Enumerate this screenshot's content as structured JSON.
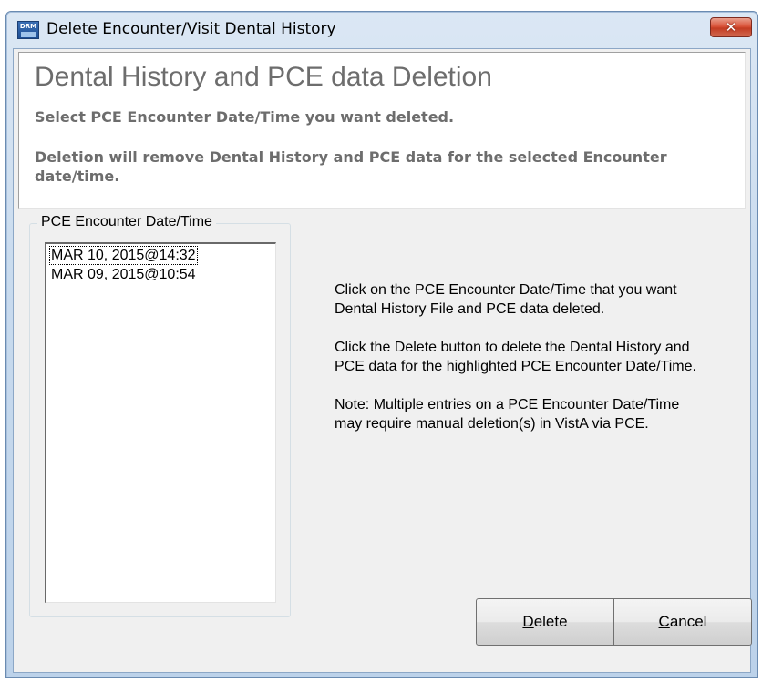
{
  "window": {
    "title": "Delete Encounter/Visit Dental History",
    "app_icon_text_top": "DRM",
    "close_glyph": "✕"
  },
  "header": {
    "title": "Dental History and PCE data Deletion",
    "line1": "Select PCE Encounter Date/Time you want deleted.",
    "line2": "Deletion will remove Dental History and PCE data for the selected Encounter date/time."
  },
  "group": {
    "legend": "PCE Encounter Date/Time",
    "items": [
      {
        "label": "MAR 10, 2015@14:32",
        "focused": true
      },
      {
        "label": "MAR 09, 2015@10:54",
        "focused": false
      }
    ]
  },
  "instructions": {
    "p1": "Click on the PCE Encounter Date/Time that you want Dental History File and PCE data deleted.",
    "p2": "Click the Delete button to delete the Dental History and PCE data for the highlighted PCE Encounter Date/Time.",
    "p3": "Note: Multiple entries on a PCE Encounter Date/Time may require manual deletion(s) in VistA via PCE."
  },
  "buttons": {
    "delete": {
      "mnemonic": "D",
      "rest": "elete"
    },
    "cancel": {
      "mnemonic": "C",
      "rest": "ancel"
    }
  },
  "colors": {
    "header_text": "#6d6d6d",
    "dialog_bg": "#f0f0f0",
    "close_button": "#c33c22"
  },
  "icons": {
    "app": "drm-app-icon",
    "close": "close-icon"
  }
}
